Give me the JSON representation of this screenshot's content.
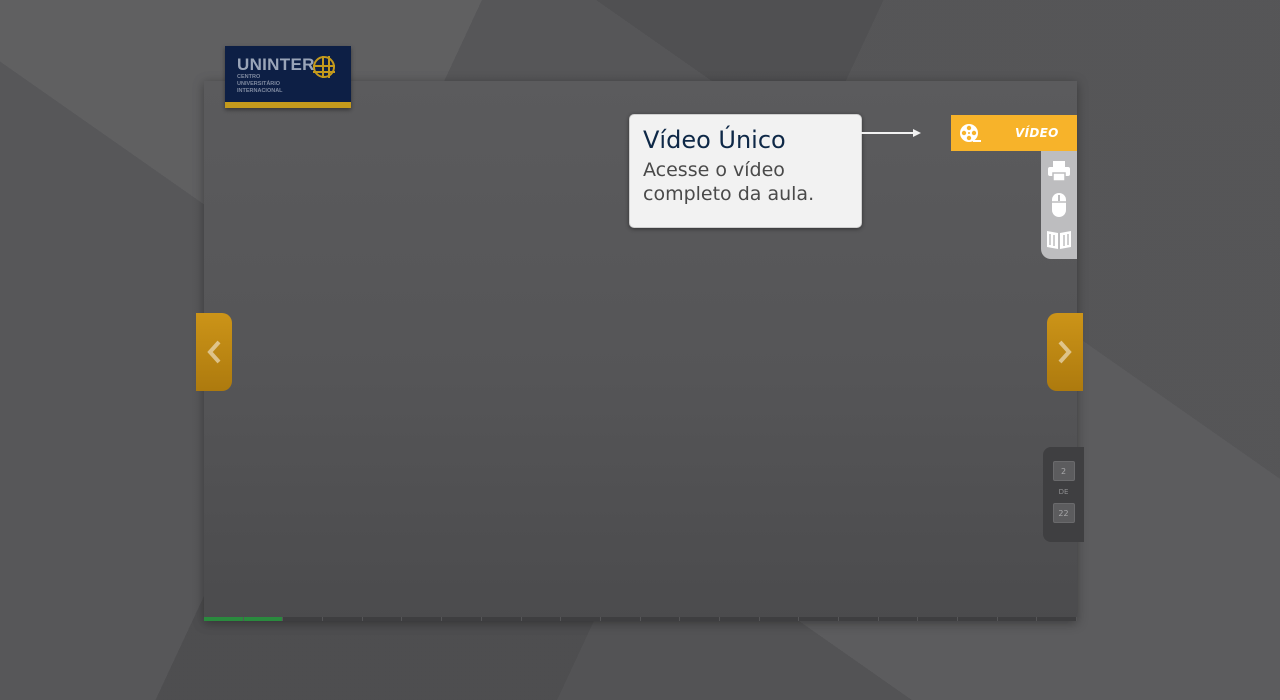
{
  "logo": {
    "name": "UNINTER",
    "sub_line_1": "CENTRO",
    "sub_line_2": "UNIVERSITÁRIO",
    "sub_line_3": "INTERNACIONAL"
  },
  "tooltip": {
    "title": "Vídeo Único",
    "body": "Acesse o vídeo completo da aula."
  },
  "video_button": {
    "label": "VÍDEO",
    "icon": "film-reel-icon",
    "color": "#f7b32a"
  },
  "toolbar": {
    "items": [
      {
        "icon": "printer-icon"
      },
      {
        "icon": "mouse-icon"
      },
      {
        "icon": "book-icon"
      }
    ]
  },
  "navigation": {
    "prev_icon": "chevron-left-icon",
    "next_icon": "chevron-right-icon",
    "color": "#cc9418"
  },
  "pager": {
    "current": "2",
    "separator": "DE",
    "total": "22"
  },
  "progress": {
    "completed": 2,
    "total": 22,
    "color": "#2a8a3e"
  }
}
